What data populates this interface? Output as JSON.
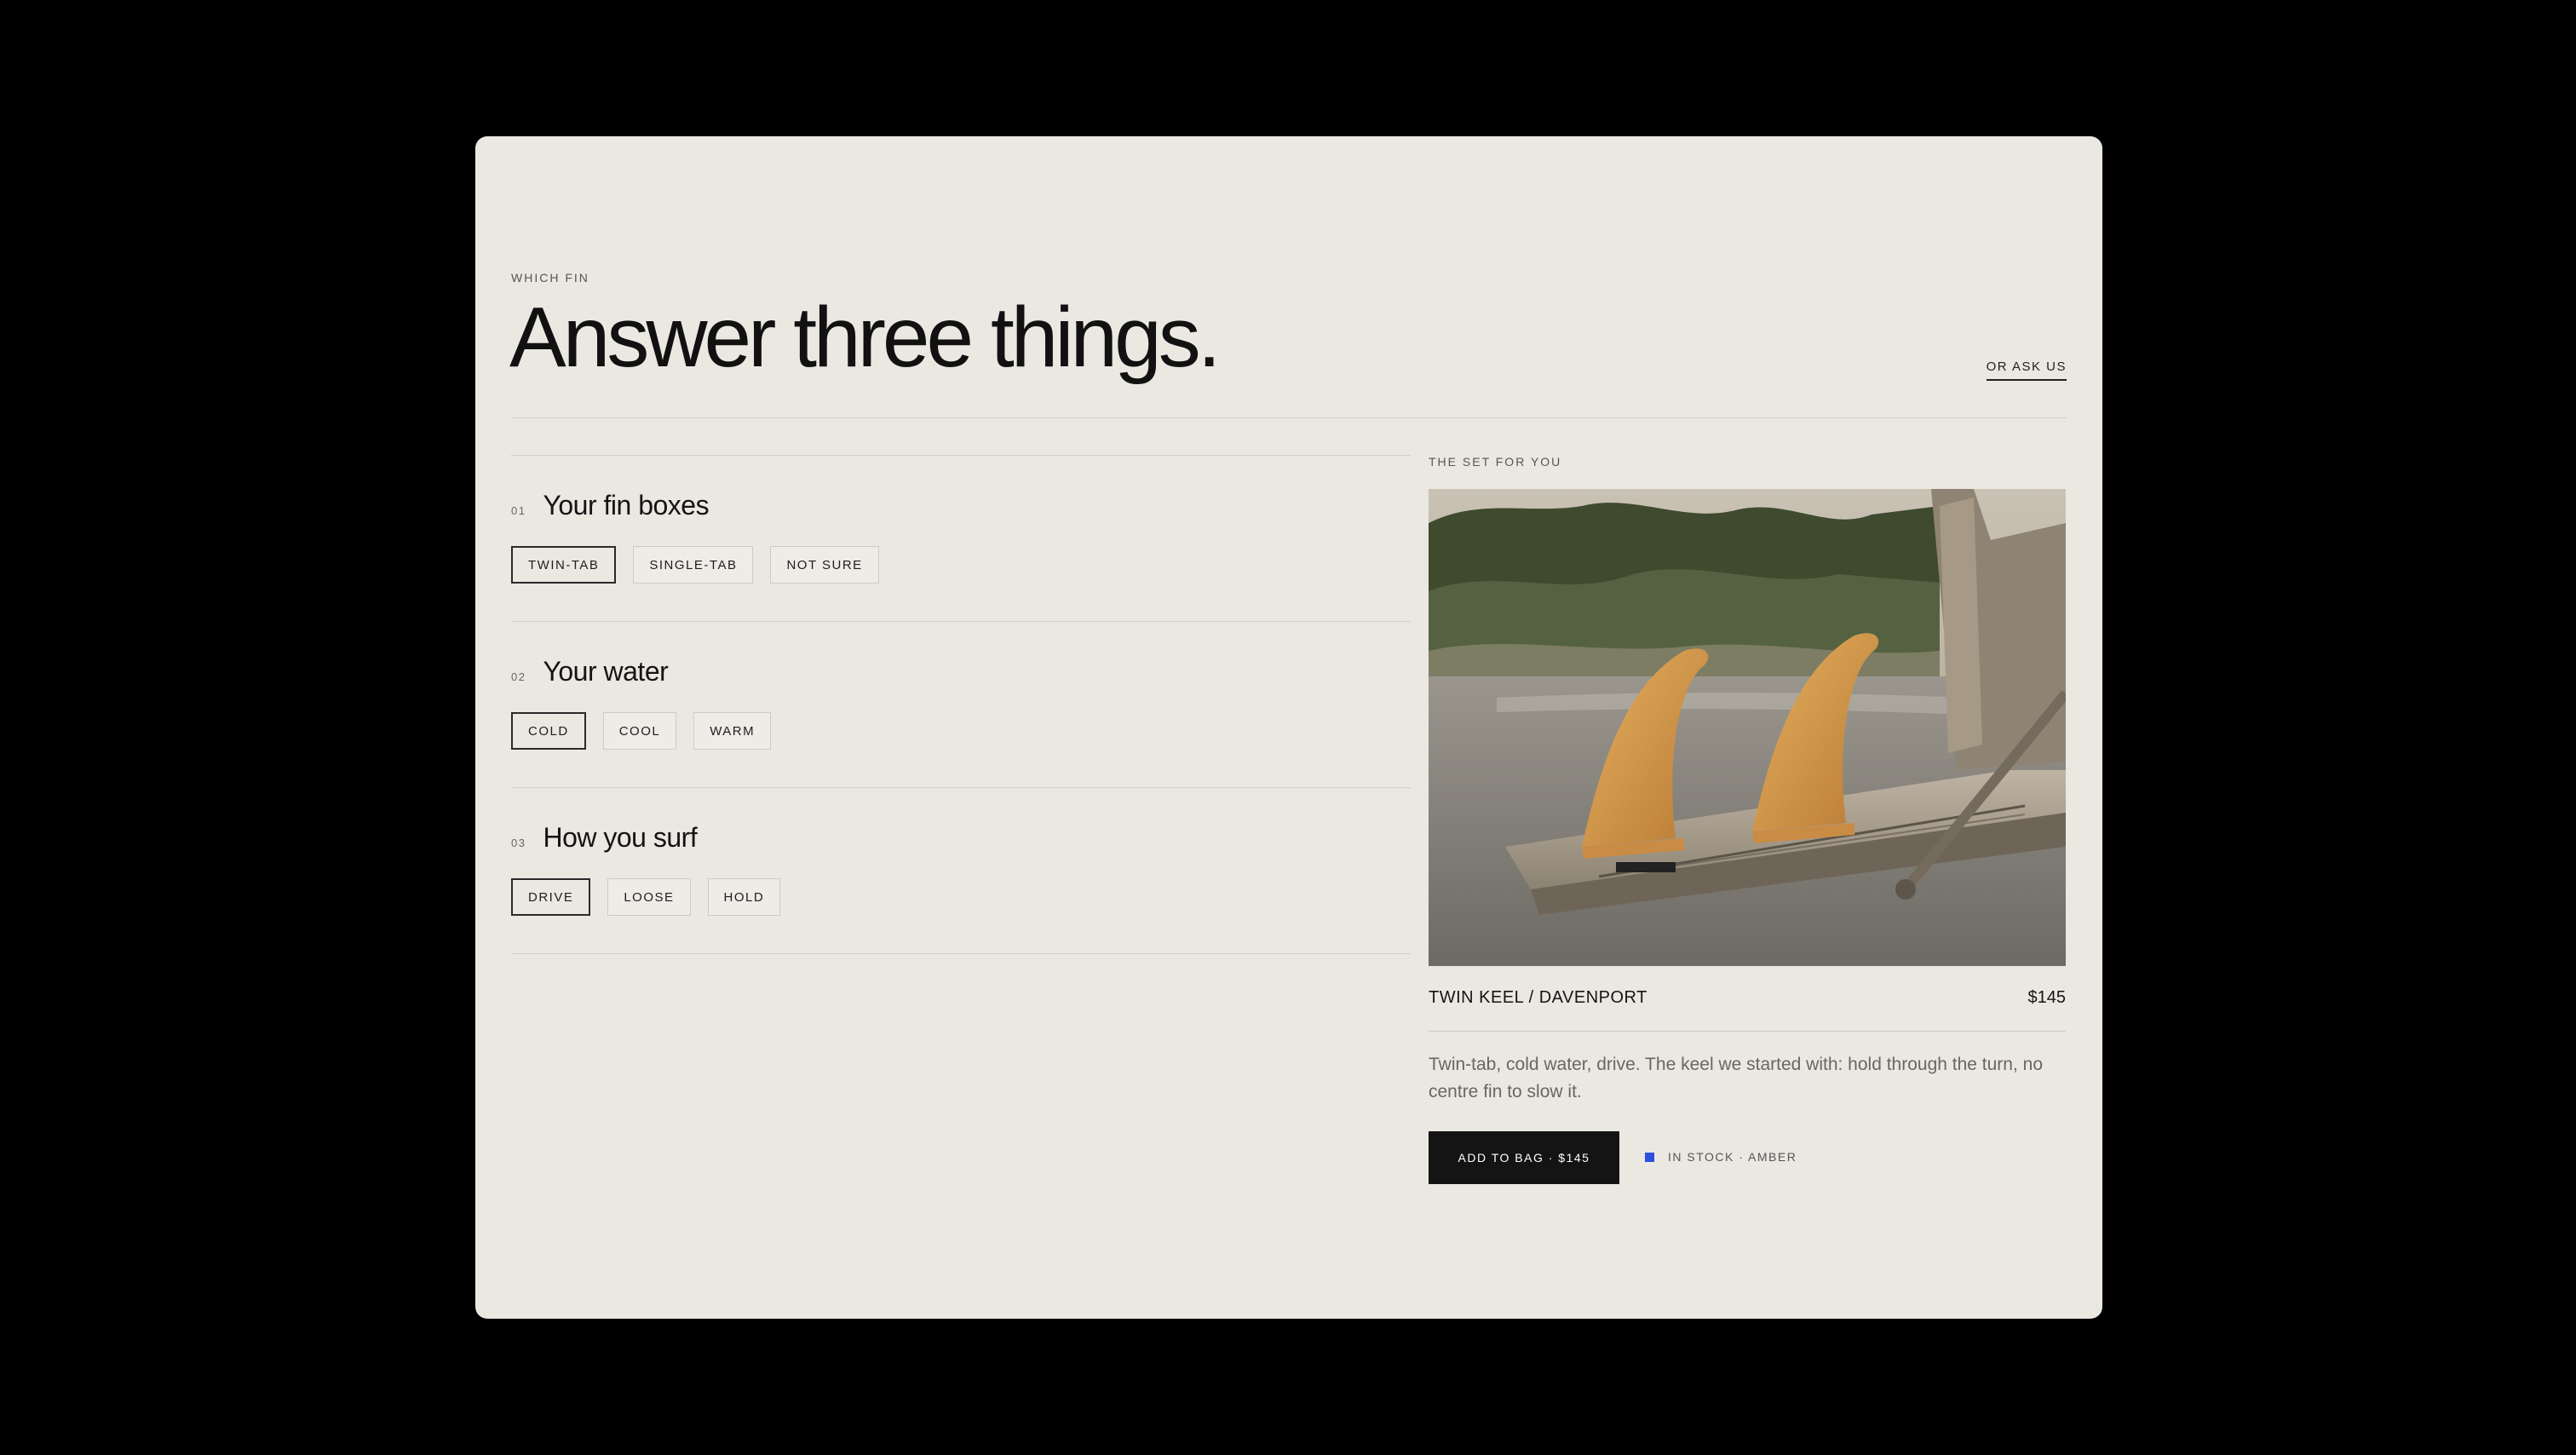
{
  "header": {
    "eyebrow": "WHICH FIN",
    "title": "Answer three things.",
    "ask_link": "OR ASK US"
  },
  "questions": [
    {
      "num": "01",
      "title": "Your fin boxes",
      "options": [
        "TWIN-TAB",
        "SINGLE-TAB",
        "NOT SURE"
      ],
      "selected": "TWIN-TAB"
    },
    {
      "num": "02",
      "title": "Your water",
      "options": [
        "COLD",
        "COOL",
        "WARM"
      ],
      "selected": "COLD"
    },
    {
      "num": "03",
      "title": "How you surf",
      "options": [
        "DRIVE",
        "LOOSE",
        "HOLD"
      ],
      "selected": "DRIVE"
    }
  ],
  "result": {
    "label": "THE SET FOR YOU",
    "name": "TWIN KEEL / DAVENPORT",
    "price": "$145",
    "description": "Twin-tab, cold water, drive. The keel we started with: hold through the turn, no centre fin to slow it.",
    "button": "ADD TO BAG · $145",
    "stock": "IN STOCK · AMBER",
    "stock_color": "#2c4fe0",
    "fin_color": "#d59a4e"
  }
}
